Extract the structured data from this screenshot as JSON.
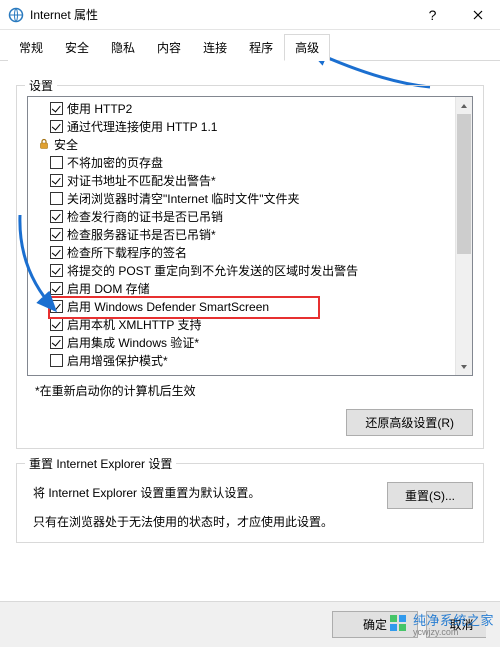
{
  "window": {
    "title": "Internet 属性",
    "help_label": "?",
    "close_label": "×"
  },
  "tabs": {
    "items": [
      "常规",
      "安全",
      "隐私",
      "内容",
      "连接",
      "程序",
      "高级"
    ],
    "active_index": 6
  },
  "settings": {
    "label": "设置",
    "items": [
      {
        "text": "使用 HTTP2",
        "checked": true,
        "kind": "check"
      },
      {
        "text": "通过代理连接使用 HTTP 1.1",
        "checked": true,
        "kind": "check"
      },
      {
        "text": "安全",
        "kind": "section",
        "icon": "lock"
      },
      {
        "text": "不将加密的页存盘",
        "checked": false,
        "kind": "check"
      },
      {
        "text": "对证书地址不匹配发出警告*",
        "checked": true,
        "kind": "check"
      },
      {
        "text": "关闭浏览器时清空\"Internet 临时文件\"文件夹",
        "checked": false,
        "kind": "check"
      },
      {
        "text": "检查发行商的证书是否已吊销",
        "checked": true,
        "kind": "check"
      },
      {
        "text": "检查服务器证书是否已吊销*",
        "checked": true,
        "kind": "check"
      },
      {
        "text": "检查所下载程序的签名",
        "checked": true,
        "kind": "check"
      },
      {
        "text": "将提交的 POST 重定向到不允许发送的区域时发出警告",
        "checked": true,
        "kind": "check"
      },
      {
        "text": "启用 DOM 存储",
        "checked": true,
        "kind": "check"
      },
      {
        "text": "启用 Windows Defender SmartScreen",
        "checked": true,
        "kind": "check",
        "highlight": true
      },
      {
        "text": "启用本机 XMLHTTP 支持",
        "checked": true,
        "kind": "check"
      },
      {
        "text": "启用集成 Windows 验证*",
        "checked": true,
        "kind": "check"
      },
      {
        "text": "启用增强保护模式*",
        "checked": false,
        "kind": "check",
        "partial": true
      }
    ],
    "note": "*在重新启动你的计算机后生效",
    "restore_button": "还原高级设置(R)"
  },
  "reset": {
    "label": "重置 Internet Explorer 设置",
    "line1": "将 Internet Explorer 设置重置为默认设置。",
    "line2": "只有在浏览器处于无法使用的状态时，才应使用此设置。",
    "button": "重置(S)..."
  },
  "buttons": {
    "ok": "确定",
    "cancel": "取消"
  },
  "watermark": {
    "brand": "纯净系统之家",
    "url": "ycwjzy.com"
  }
}
